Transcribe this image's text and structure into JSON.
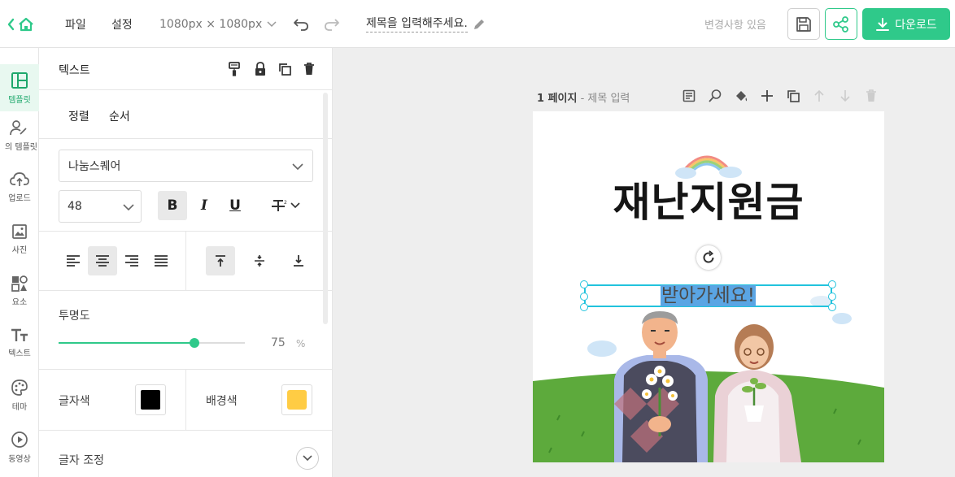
{
  "topbar": {
    "menu_file": "파일",
    "menu_settings": "설정",
    "size_label": "1080px × 1080px",
    "title": "제목을 입력해주세요.",
    "changes_status": "변경사항 있음",
    "download_label": "다운로드"
  },
  "rail": {
    "items": [
      {
        "label": "템플릿",
        "icon": "layout-icon"
      },
      {
        "label": "의 템플릿",
        "icon": "my-template-icon"
      },
      {
        "label": "업로드",
        "icon": "upload-icon"
      },
      {
        "label": "사진",
        "icon": "photo-icon"
      },
      {
        "label": "요소",
        "icon": "elements-icon"
      },
      {
        "label": "텍스트",
        "icon": "text-icon"
      },
      {
        "label": "테마",
        "icon": "palette-icon"
      },
      {
        "label": "동영상",
        "icon": "video-icon"
      }
    ]
  },
  "panel": {
    "title": "텍스트",
    "tab_align": "정렬",
    "tab_order": "순서",
    "font_family": "나눔스퀘어",
    "font_size": "48",
    "bold": "B",
    "italic": "I",
    "underline": "U",
    "opacity_label": "투명도",
    "opacity_value": "75",
    "opacity_unit": "%",
    "opacity_fraction": 0.75,
    "text_color_label": "글자색",
    "text_color": "#000000",
    "bg_color_label": "배경색",
    "bg_color": "#ffcc44",
    "adjust_label": "글자 조정"
  },
  "canvas": {
    "page_label": "1 페이지",
    "page_title_placeholder": "- 제목 입력",
    "heading": "재난지원금",
    "subtext": "받아가세요!"
  },
  "colors": {
    "accent": "#2fc98a",
    "selection": "#22c3dd",
    "text_highlight": "#5aa5e4",
    "grass": "#5daa3c"
  }
}
